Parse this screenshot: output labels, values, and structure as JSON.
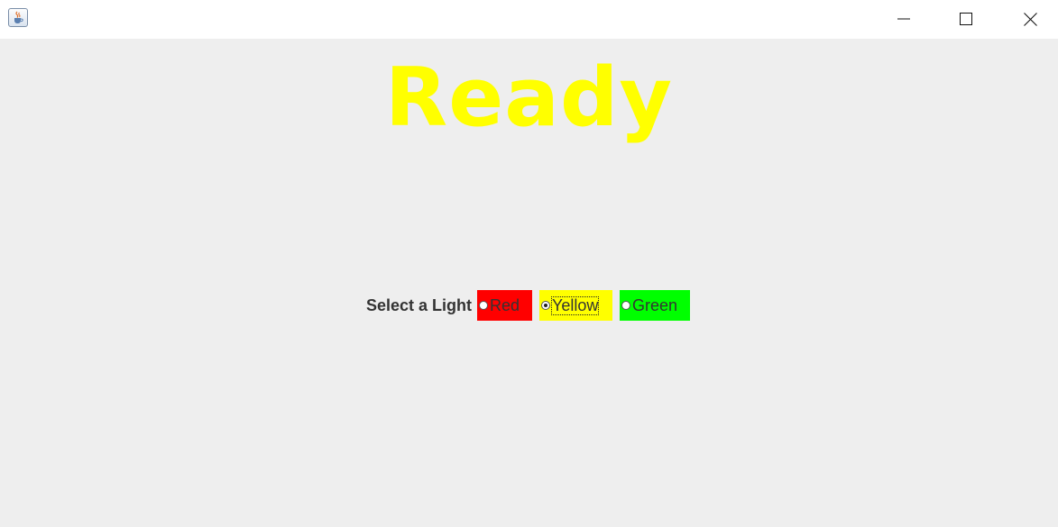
{
  "window": {
    "title": "",
    "icon": "java-cup-icon",
    "controls": [
      "minimize-icon",
      "maximize-icon",
      "close-icon"
    ]
  },
  "status": {
    "text": "Ready",
    "color": "#ffff00"
  },
  "light_selector": {
    "label": "Select a Light",
    "options": [
      {
        "label": "Red",
        "background": "#ff0000",
        "checked": false
      },
      {
        "label": "Yellow",
        "background": "#ffff00",
        "checked": true
      },
      {
        "label": "Green",
        "background": "#00ff00",
        "checked": false
      }
    ],
    "selected": "Yellow"
  }
}
